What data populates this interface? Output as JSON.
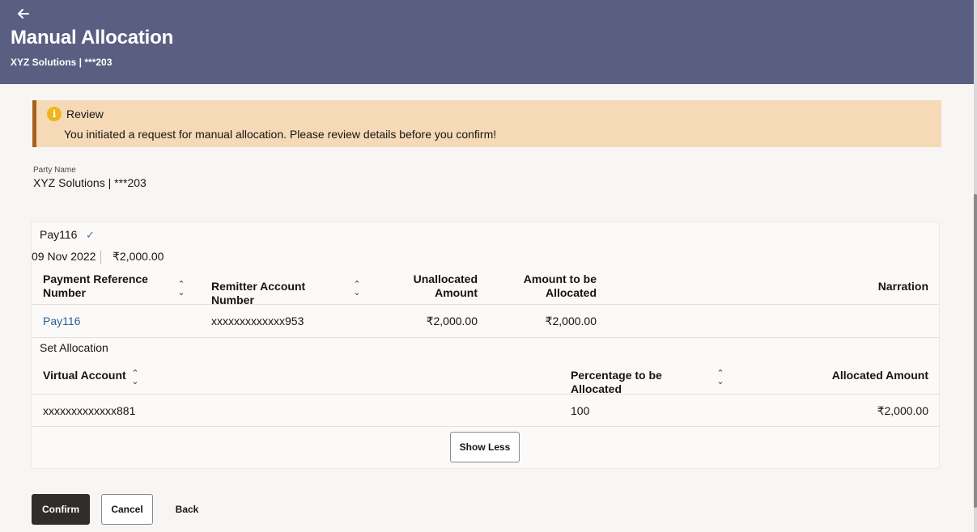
{
  "header": {
    "title": "Manual Allocation",
    "subtitle": "XYZ Solutions | ***203",
    "back_icon": "arrow-left-icon"
  },
  "alert": {
    "icon": "info-icon",
    "icon_glyph": "i",
    "title": "Review",
    "message": "You initiated a request for manual allocation. Please review details before you confirm!"
  },
  "party": {
    "label": "Party Name",
    "value": "XYZ Solutions | ***203"
  },
  "payment": {
    "reference": "Pay116",
    "check_glyph": "✓",
    "date": "09 Nov 2022",
    "amount": "₹2,000.00"
  },
  "payment_table": {
    "columns": {
      "payment_ref": "Payment Reference Number",
      "remitter_account": "Remitter Account Number",
      "unallocated": "Unallocated Amount",
      "to_allocate": "Amount to be Allocated",
      "narration": "Narration"
    },
    "row": {
      "payment_ref": "Pay116",
      "remitter_account": "xxxxxxxxxxxxx953",
      "unallocated": "₹2,000.00",
      "to_allocate": "₹2,000.00",
      "narration": ""
    }
  },
  "allocation": {
    "title": "Set Allocation",
    "columns": {
      "virtual_account": "Virtual Account",
      "percentage": "Percentage to be Allocated",
      "allocated_amount": "Allocated Amount"
    },
    "row": {
      "virtual_account": "xxxxxxxxxxxxx881",
      "percentage": "100",
      "allocated_amount": "₹2,000.00"
    }
  },
  "sort_glyph": "⌃⌄",
  "buttons": {
    "show_less": "Show Less",
    "confirm": "Confirm",
    "cancel": "Cancel",
    "back": "Back"
  },
  "colors": {
    "header_bg": "#5a5f82",
    "alert_bg": "#f6d9b7",
    "alert_border": "#a6611c",
    "info_icon": "#f0b41c",
    "link": "#2d5f93",
    "primary_button": "#312d2a"
  }
}
